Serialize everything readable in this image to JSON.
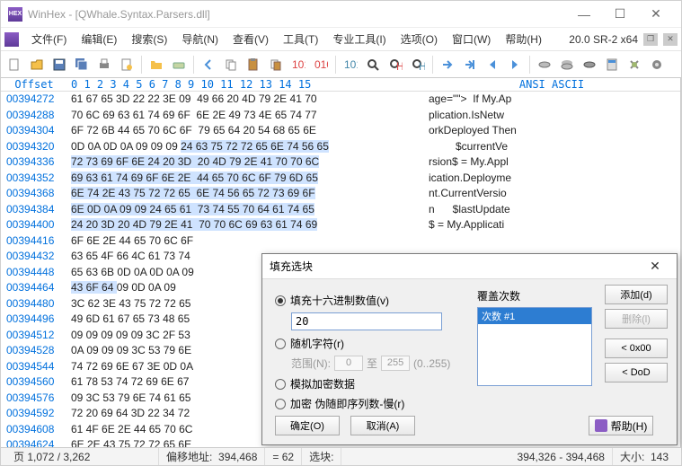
{
  "title": "WinHex - [QWhale.Syntax.Parsers.dll]",
  "version_tag": "20.0 SR-2 x64",
  "menu": [
    "文件(F)",
    "编辑(E)",
    "搜索(S)",
    "导航(N)",
    "查看(V)",
    "工具(T)",
    "专业工具(I)",
    "选项(O)",
    "窗口(W)",
    "帮助(H)"
  ],
  "header": {
    "offset": "Offset",
    "cols": " 0  1  2  3  4  5  6  7   8  9 10 11 12 13 14 15",
    "ascii": "ANSI ASCII"
  },
  "rows": [
    {
      "o": "00394272",
      "b": "61 67 65 3D 22 22 3E 09  49 66 20 4D 79 2E 41 70",
      "a": "age=\"\">  If My.Ap"
    },
    {
      "o": "00394288",
      "b": "70 6C 69 63 61 74 69 6F  6E 2E 49 73 4E 65 74 77",
      "a": "plication.IsNetw"
    },
    {
      "o": "00394304",
      "b": "6F 72 6B 44 65 70 6C 6F  79 65 64 20 54 68 65 6E",
      "a": "orkDeployed Then"
    },
    {
      "o": "00394320",
      "b": "0D 0A 0D 0A 09 09 09 ",
      "bs": "24 63 75 72 72 65 6E 74 56 65",
      "a": "         $currentVe"
    },
    {
      "o": "00394336",
      "b": "",
      "bs": "72 73 69 6F 6E 24 20 3D  20 4D 79 2E 41 70 70 6C",
      "a": "rsion$ = My.Appl"
    },
    {
      "o": "00394352",
      "b": "",
      "bs": "69 63 61 74 69 6F 6E 2E  44 65 70 6C 6F 79 6D 65",
      "a": "ication.Deployme"
    },
    {
      "o": "00394368",
      "b": "",
      "bs": "6E 74 2E 43 75 72 72 65  6E 74 56 65 72 73 69 6F",
      "a": "nt.CurrentVersio"
    },
    {
      "o": "00394384",
      "b": "",
      "bs": "6E 0D 0A 09 09 24 65 61  73 74 55 70 64 61 74 65",
      "a": "n      $lastUpdate"
    },
    {
      "o": "00394400",
      "b": "",
      "bs": "24 20 3D 20 4D 79 2E 41  70 70 6C 69 63 61 74 69",
      "a": "$ = My.Applicati"
    },
    {
      "o": "00394416",
      "b": "6F 6E 2E 44 65 70 6C 6F",
      "a": ""
    },
    {
      "o": "00394432",
      "b": "63 65 4F 66 4C 61 73 74",
      "a": ""
    },
    {
      "o": "00394448",
      "b": "65 63 6B 0D 0A 0D 0A 09",
      "a": ""
    },
    {
      "o": "00394464",
      "b": "",
      "bs": "43 6F 64 ",
      "b2": "09 0D 0A 09",
      "a": ""
    },
    {
      "o": "00394480",
      "b": "3C 62 3E 43 75 72 72 65",
      "a": ""
    },
    {
      "o": "00394496",
      "b": "49 6D 61 67 65 73 48 65",
      "a": ""
    },
    {
      "o": "00394512",
      "b": "09 09 09 09 09 3C 2F 53",
      "a": ""
    },
    {
      "o": "00394528",
      "b": "0A 09 09 09 3C 53 79 6E",
      "a": ""
    },
    {
      "o": "00394544",
      "b": "74 72 69 6E 67 3E 0D 0A",
      "a": ""
    },
    {
      "o": "00394560",
      "b": "61 78 53 74 72 69 6E 67",
      "a": ""
    },
    {
      "o": "00394576",
      "b": "09 3C 53 79 6E 74 61 65",
      "a": ""
    },
    {
      "o": "00394592",
      "b": "72 20 69 64 3D 22 34 72",
      "a": ""
    },
    {
      "o": "00394608",
      "b": "61 4F 6E 2E 44 65 70 6C",
      "a": ""
    },
    {
      "o": "00394624",
      "b": "6E 2E 43 75 72 72 65 6E",
      "a": ""
    }
  ],
  "dialog": {
    "title": "填充选块",
    "opt_hex": "填充十六进制数值(v)",
    "hex_value": "20",
    "opt_random": "随机字符(r)",
    "range_label": "范围(N):",
    "range_from": "0",
    "range_to_lbl": "至",
    "range_to": "255",
    "range_hint": "(0..255)",
    "opt_encrypt": "模拟加密数据",
    "opt_slow": "加密 伪随即序列数-慢(r)",
    "repeat_label": "覆盖次数",
    "repeat_item": "次数 #1",
    "btn_add": "添加(d)",
    "btn_del": "删除(l)",
    "btn_0x00": "< 0x00",
    "btn_dod": "< DoD",
    "btn_ok": "确定(O)",
    "btn_cancel": "取消(A)",
    "btn_help": "帮助(H)"
  },
  "status": {
    "page": "页 1,072 / 3,262",
    "offset_lbl": "偏移地址:",
    "offset_val": "394,468",
    "eq": "= 62",
    "sel_lbl": "选块:",
    "sel_val": "394,326 - 394,468",
    "size_lbl": "大小:",
    "size_val": "143"
  }
}
